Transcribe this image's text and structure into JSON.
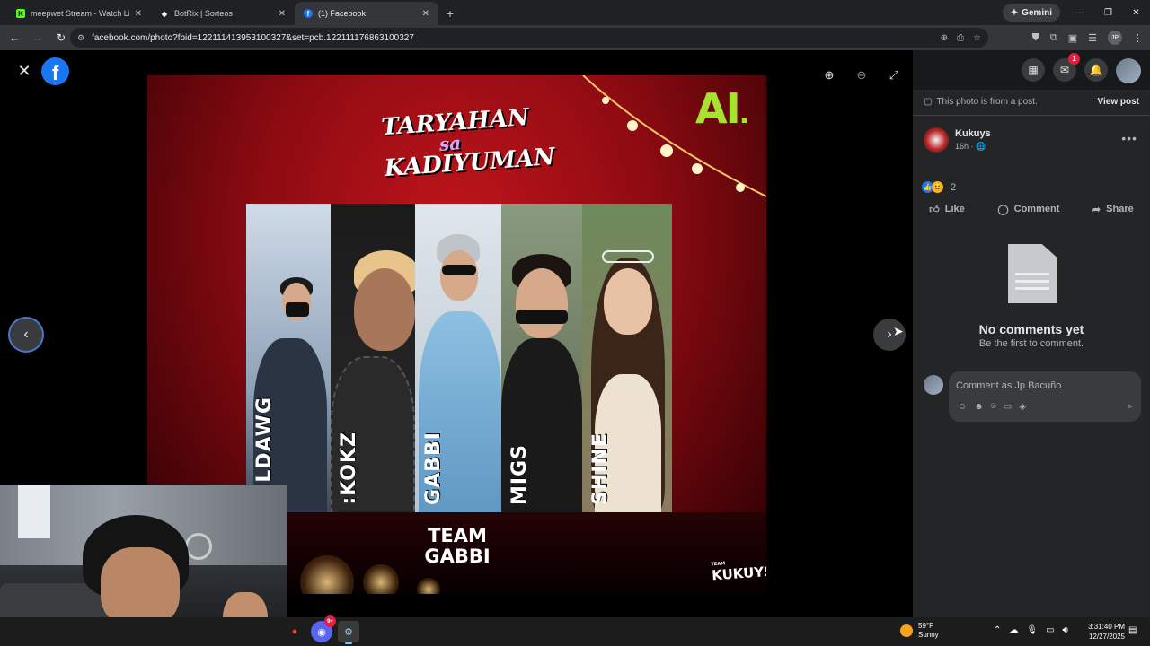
{
  "browser": {
    "tabs": [
      {
        "title": "meepwet Stream - Watch Live o",
        "favicon": "kick-icon",
        "color": "#53fc18",
        "glyph": "K"
      },
      {
        "title": "BotRix | Sorteos",
        "favicon": "botrix-icon",
        "color": "#ffffff",
        "glyph": "◆"
      },
      {
        "title": "(1) Facebook",
        "favicon": "facebook-icon",
        "color": "#1877f2",
        "glyph": "f"
      }
    ],
    "new_tab": "+",
    "gemini_label": "Gemini",
    "url": "facebook.com/photo?fbid=122111413953100327&set=pcb.122111176863100327",
    "profile_initials": "JP"
  },
  "viewer": {
    "poster": {
      "title_line1": "TARYAHAN",
      "title_line2": "sa",
      "title_line3": "KADIYUMAN",
      "brand": "AI",
      "team_line1": "TEAM",
      "team_line2": "GABBI",
      "watermark_small": "TEAM",
      "watermark": "KUKUYS",
      "members": [
        {
          "name": "EILDAWG"
        },
        {
          "name": ":KOKZ"
        },
        {
          "name": "GABBI"
        },
        {
          "name": "MIGS"
        },
        {
          "name": "SHINE"
        }
      ]
    }
  },
  "panel": {
    "notification_count": "1",
    "post_note": "This photo is from a post.",
    "view_post": "View post",
    "author": {
      "name": "Kukuys",
      "meta": "16h · 🌐"
    },
    "reaction_count": "2",
    "actions": {
      "like": "Like",
      "comment": "Comment",
      "share": "Share"
    },
    "empty_title": "No comments yet",
    "empty_sub": "Be the first to comment.",
    "comment_placeholder": "Comment as Jp Bacuño"
  },
  "taskbar": {
    "weather_temp": "59°F",
    "weather_desc": "Sunny",
    "time": "3:31:40 PM",
    "date": "12/27/2025",
    "discord_badge": "9+"
  }
}
